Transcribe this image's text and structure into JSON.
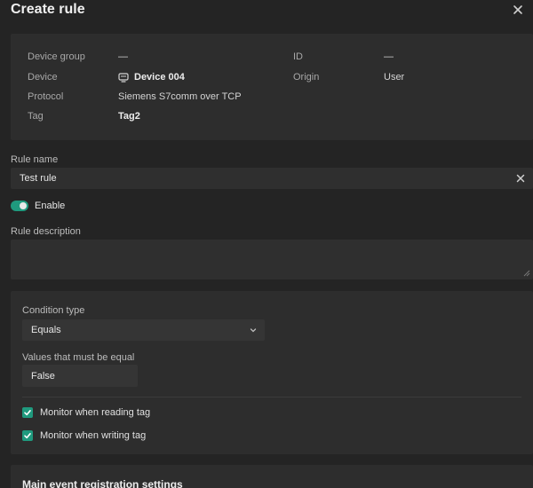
{
  "dialog": {
    "title": "Create rule"
  },
  "info": {
    "device_group_label": "Device group",
    "device_group_value": "—",
    "device_label": "Device",
    "device_value": "Device 004",
    "protocol_label": "Protocol",
    "protocol_value": "Siemens S7comm over TCP",
    "tag_label": "Tag",
    "tag_value": "Tag2",
    "id_label": "ID",
    "id_value": "—",
    "origin_label": "Origin",
    "origin_value": "User"
  },
  "rule_name": {
    "label": "Rule name",
    "value": "Test rule"
  },
  "enable": {
    "label": "Enable",
    "on": true
  },
  "rule_description": {
    "label": "Rule description",
    "value": ""
  },
  "condition": {
    "type_label": "Condition type",
    "type_value": "Equals",
    "values_label": "Values that must be equal",
    "values_value": "False",
    "monitor_reading_label": "Monitor when reading tag",
    "monitor_reading_checked": true,
    "monitor_writing_label": "Monitor when writing tag",
    "monitor_writing_checked": true
  },
  "main_event": {
    "title": "Main event registration settings"
  },
  "colors": {
    "accent": "#1f9a7e",
    "background": "#242424",
    "panel": "#2d2d2d"
  },
  "icons": {
    "close": "close-icon",
    "clear": "clear-icon",
    "device": "monitor-icon",
    "chevron": "chevron-down-icon",
    "check": "checkmark-icon"
  }
}
